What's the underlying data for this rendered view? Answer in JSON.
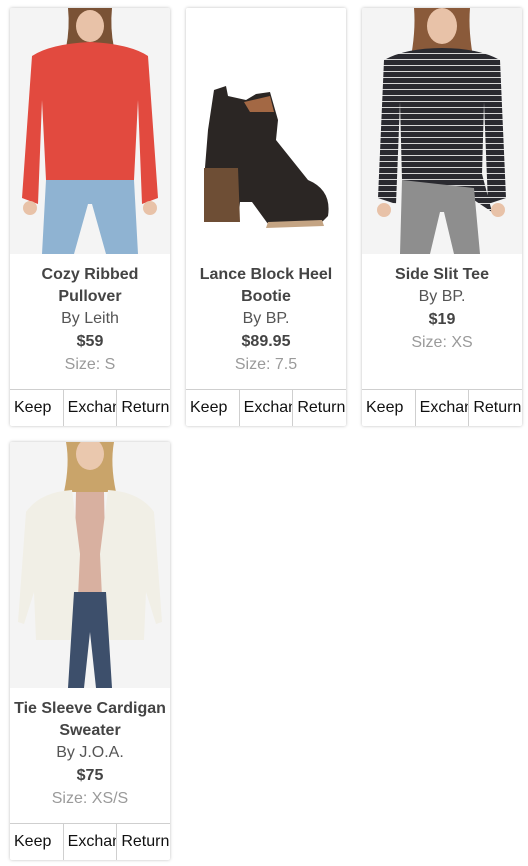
{
  "products": [
    {
      "title": "Cozy Ribbed Pullover",
      "brand": "By Leith",
      "price": "$59",
      "size": "Size: S",
      "actions": [
        "Keep",
        "Exchange",
        "Return"
      ]
    },
    {
      "title": "Lance Block Heel Bootie",
      "brand": "By BP.",
      "price": "$89.95",
      "size": "Size: 7.5",
      "actions": [
        "Keep",
        "Exchange",
        "Return"
      ]
    },
    {
      "title": "Side Slit Tee",
      "brand": "By BP.",
      "price": "$19",
      "size": "Size: XS",
      "actions": [
        "Keep",
        "Exchange",
        "Return"
      ]
    },
    {
      "title": "Tie Sleeve Cardigan Sweater",
      "brand": "By J.O.A.",
      "price": "$75",
      "size": "Size: XS/S",
      "actions": [
        "Keep",
        "Exchange",
        "Return"
      ]
    }
  ],
  "colors": {
    "pullover": "#e24a3f",
    "bootie": "#2b2624",
    "tee": "#2a2a30",
    "cardigan": "#f1efe6",
    "jeans": "#8fb3d2"
  }
}
